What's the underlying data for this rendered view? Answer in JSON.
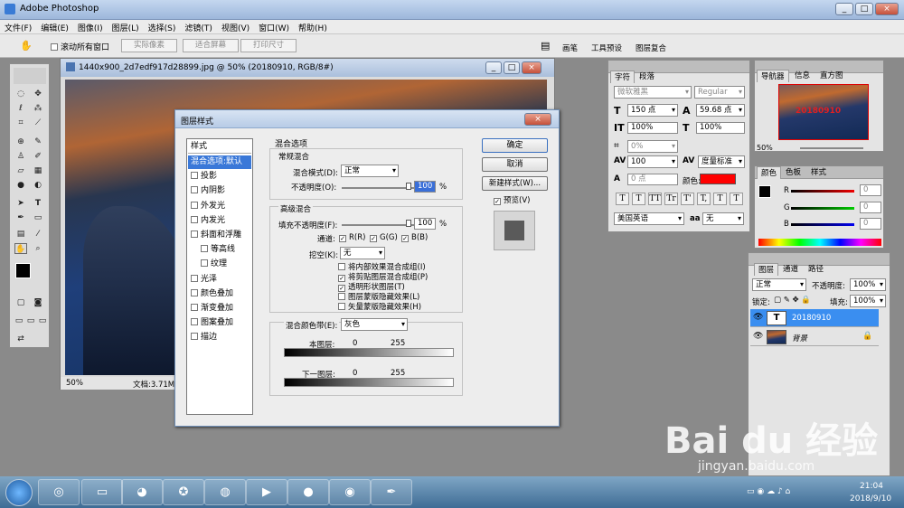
{
  "app": {
    "title": "Adobe Photoshop",
    "controls": [
      "_",
      "□",
      "×"
    ]
  },
  "menu": [
    "文件(F)",
    "编辑(E)",
    "图像(I)",
    "图层(L)",
    "选择(S)",
    "滤镜(T)",
    "视图(V)",
    "窗口(W)",
    "帮助(H)"
  ],
  "options": {
    "scroll_all": "滚动所有窗口",
    "actual_pixels": "实际像素",
    "fit_screen": "适合屏幕",
    "print_size": "打印尺寸",
    "well_tabs": [
      "画笔",
      "工具预设",
      "图层复合"
    ]
  },
  "document": {
    "title": "1440x900_2d7edf917d28899.jpg @ 50% (20180910, RGB/8#)",
    "zoom": "50%",
    "status": "文档:3.71M",
    "canvas_text": "2"
  },
  "dialog": {
    "title": "图层样式",
    "styles_header": "样式",
    "styles": [
      {
        "label": "混合选项:默认",
        "checkbox": false,
        "selected": true
      },
      {
        "label": "投影",
        "checkbox": true
      },
      {
        "label": "内阴影",
        "checkbox": true
      },
      {
        "label": "外发光",
        "checkbox": true
      },
      {
        "label": "内发光",
        "checkbox": true
      },
      {
        "label": "斜面和浮雕",
        "checkbox": true
      },
      {
        "label": "等高线",
        "checkbox": true,
        "indent": true
      },
      {
        "label": "纹理",
        "checkbox": true,
        "indent": true
      },
      {
        "label": "光泽",
        "checkbox": true
      },
      {
        "label": "颜色叠加",
        "checkbox": true
      },
      {
        "label": "渐变叠加",
        "checkbox": true
      },
      {
        "label": "图案叠加",
        "checkbox": true
      },
      {
        "label": "描边",
        "checkbox": true
      }
    ],
    "blend_options": "混合选项",
    "general_blend": "常规混合",
    "blend_mode_label": "混合模式(D):",
    "blend_mode": "正常",
    "opacity_label": "不透明度(O):",
    "opacity": "100",
    "pct": "%",
    "advanced_blend": "高级混合",
    "fill_opacity_label": "填充不透明度(F):",
    "fill_opacity": "100",
    "channels_label": "通道:",
    "ch_r": "R(R)",
    "ch_g": "G(G)",
    "ch_b": "B(B)",
    "knockout_label": "挖空(K):",
    "knockout": "无",
    "opts": [
      {
        "label": "将内部效果混合成组(I)",
        "on": false
      },
      {
        "label": "将剪贴图层混合成组(P)",
        "on": true
      },
      {
        "label": "透明形状图层(T)",
        "on": true
      },
      {
        "label": "图层蒙版隐藏效果(L)",
        "on": false
      },
      {
        "label": "矢量蒙版隐藏效果(H)",
        "on": false
      }
    ],
    "blend_if_label": "混合颜色带(E):",
    "blend_if": "灰色",
    "this_layer": "本图层:",
    "underlying": "下一图层:",
    "v0": "0",
    "v255": "255",
    "ok": "确定",
    "cancel": "取消",
    "new_style": "新建样式(W)...",
    "preview": "预览(V)"
  },
  "char_panel": {
    "tabs": [
      "字符",
      "段落"
    ],
    "font": "微软雅黑",
    "weight": "Regular",
    "size": "150 点",
    "leading": "59.68 点",
    "v_scale": "100%",
    "h_scale": "100%",
    "tracking": "0%",
    "kerning": "100",
    "kern_mode": "度量标准",
    "baseline": "0 点",
    "color_label": "颜色:",
    "color": "#ff0000",
    "language": "美国英语",
    "aa_label": "aa",
    "aa": "无",
    "type_buttons": [
      "T",
      "T",
      "TT",
      "Tr",
      "T'",
      "T,",
      "T",
      "T"
    ]
  },
  "nav_panel": {
    "tabs": [
      "导航器",
      "信息",
      "直方图"
    ],
    "zoom": "50%",
    "thumb_text": "20180910"
  },
  "color_panel": {
    "tabs": [
      "颜色",
      "色板",
      "样式"
    ],
    "r_label": "R",
    "g_label": "G",
    "b_label": "B",
    "r": "0",
    "g": "0",
    "b": "0"
  },
  "layers_panel": {
    "tabs": [
      "图层",
      "通道",
      "路径"
    ],
    "mode": "正常",
    "opacity_label": "不透明度:",
    "opacity": "100%",
    "lock_label": "锁定:",
    "fill_label": "填充:",
    "fill": "100%",
    "layers": [
      {
        "name": "20180910",
        "type": "text",
        "selected": true
      },
      {
        "name": "背景",
        "type": "image",
        "locked": true
      }
    ]
  },
  "taskbar": {
    "time": "21:04",
    "date": "2018/9/10"
  },
  "watermark": {
    "logo": "Bai du 经验",
    "url": "jingyan.baidu.com"
  }
}
